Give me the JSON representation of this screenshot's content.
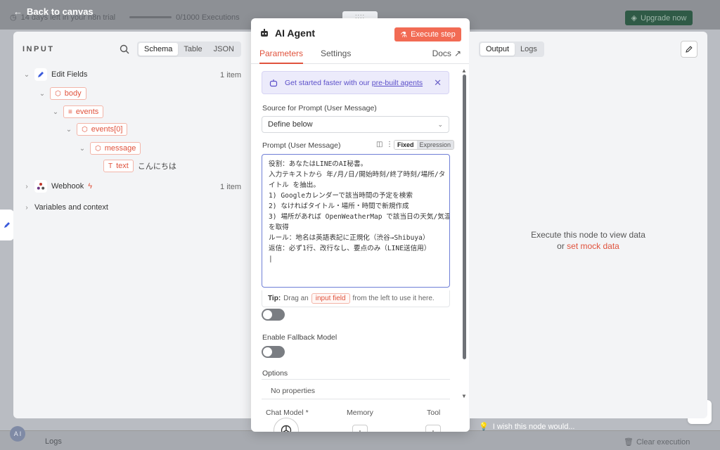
{
  "app": {
    "back_label": "Back to canvas",
    "trial_text": "14 days left in your n8n trial",
    "executions_text": "0/1000 Executions",
    "upgrade_label": "Upgrade now",
    "logs_label": "Logs",
    "clear_execution_label": "Clear execution",
    "avatar_initials": "A I",
    "wish_text": "I wish this node would..."
  },
  "input_panel": {
    "title": "INPUT",
    "view_options": [
      "Schema",
      "Table",
      "JSON"
    ],
    "active_view": "Schema",
    "tree": {
      "edit_fields": {
        "label": "Edit Fields",
        "count": "1 item"
      },
      "body": "body",
      "events": "events",
      "events_0": "events[0]",
      "message": "message",
      "text_key": "text",
      "text_value": "こんにちは",
      "webhook": {
        "label": "Webhook",
        "count": "1 item"
      },
      "variables": "Variables and context"
    }
  },
  "node": {
    "title": "AI Agent",
    "execute_label": "Execute step",
    "tabs": [
      "Parameters",
      "Settings"
    ],
    "active_tab": "Parameters",
    "docs_label": "Docs",
    "callout_text": "Get started faster with our",
    "callout_link": "pre-built agents",
    "source_label": "Source for Prompt (User Message)",
    "source_value": "Define below",
    "prompt_label": "Prompt (User Message)",
    "mode_fixed": "Fixed",
    "mode_expression": "Expression",
    "prompt_lines": [
      "役割：あなたはLINEのAI秘書。",
      "入力テキストから 年/月/日/開始時刻/終了時刻/場所/タ",
      "イトル を抽出。",
      "1) Googleカレンダーで該当時間の予定を検索",
      "2) なければタイトル・場所・時間で新規作成",
      "3) 場所があれば OpenWeatherMap で該当日の天気/気温",
      "を取得",
      "ルール：地名は英語表記に正規化（渋谷→Shibuya）",
      "返信：必ず1行、改行なし、要点のみ（LINE送信用）",
      "|"
    ],
    "tip_bold": "Tip:",
    "tip_before": "Drag an",
    "tip_highlight": "input field",
    "tip_after": "from the left to use it here.",
    "fallback_label": "Enable Fallback Model",
    "options_label": "Options",
    "no_properties": "No properties",
    "connectors": [
      "Chat Model *",
      "Memory",
      "Tool"
    ]
  },
  "output_panel": {
    "view_options": [
      "Output",
      "Logs"
    ],
    "active_view": "Output",
    "message_line1": "Execute this node to view data",
    "message_or": "or",
    "mock_link": "set mock data"
  },
  "colors": {
    "accent": "#e0533d",
    "execute_bg": "#f26b54",
    "callout_bg": "#ecebfb",
    "callout_text": "#5b4fc9",
    "upgrade_bg": "#2f5a46"
  }
}
